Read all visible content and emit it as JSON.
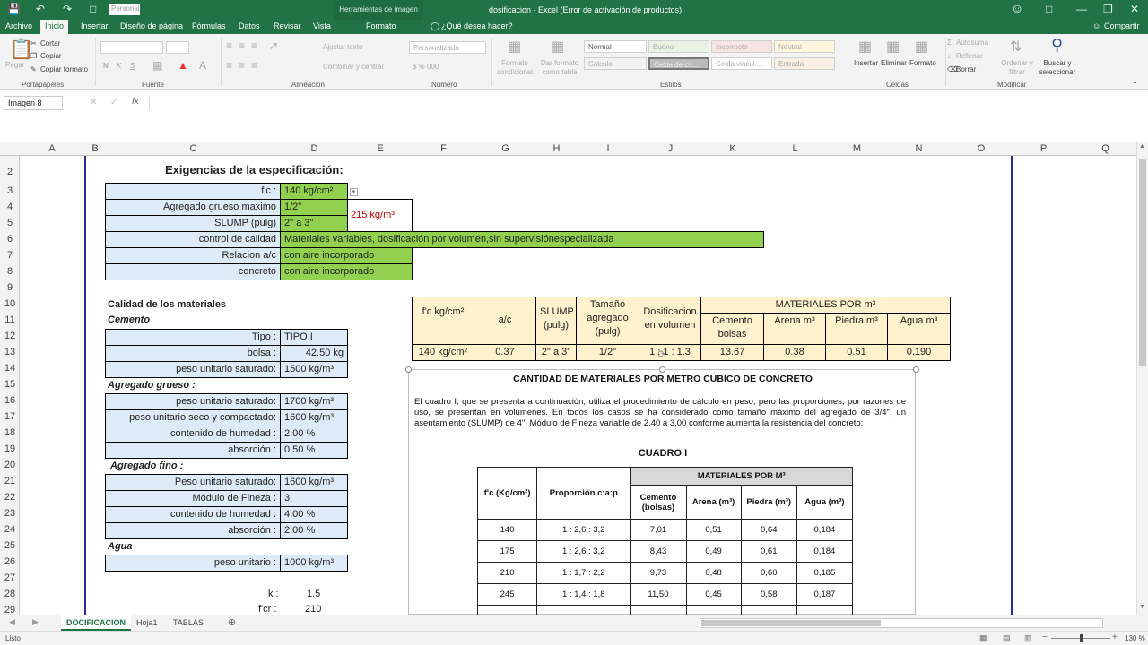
{
  "titlebar": {
    "doc_title": "dosificacion - Excel (Error de activación de productos)",
    "context_tab": "Herramientas de imagen",
    "font_box": "Personal"
  },
  "tabs": [
    "Archivo",
    "Inicio",
    "Insertar",
    "Diseño de página",
    "Fórmulas",
    "Datos",
    "Revisar",
    "Vista",
    "Formato"
  ],
  "tell_me": "¿Qué desea hacer?",
  "share": "Compartir",
  "ribbon": {
    "clipboard": {
      "paste": "Pegar",
      "cut": "Cortar",
      "copy": "Copiar",
      "format_painter": "Copiar formato",
      "label": "Portapapeles"
    },
    "font": {
      "label": "Fuente",
      "bold": "N",
      "italic": "K",
      "underline": "S"
    },
    "alignment": {
      "wrap": "Ajustar texto",
      "merge": "Combinar y centrar",
      "label": "Alineación"
    },
    "number": {
      "format": "Personalizada",
      "label": "Número"
    },
    "styles": {
      "conditional": "Formato condicional",
      "as_table": "Dar formato como tabla",
      "normal": "Normal",
      "bueno": "Bueno",
      "incorrecto": "Incorrecto",
      "neutral": "Neutral",
      "calculo": "Cálculo",
      "celda_co": "Celda de co...",
      "celda_vinc": "Celda vincul...",
      "entrada": "Entrada",
      "label": "Estilos"
    },
    "cells": {
      "insert": "Insertar",
      "delete": "Eliminar",
      "format": "Formato",
      "label": "Celdas"
    },
    "editing": {
      "autosum": "Autosuma",
      "fill": "Rellenar",
      "clear": "Borrar",
      "sort": "Ordenar y filtrar",
      "find": "Buscar y seleccionar",
      "label": "Modificar"
    }
  },
  "namebox": "Imagen 8",
  "fx": "fx",
  "columns": [
    "A",
    "B",
    "C",
    "D",
    "E",
    "F",
    "G",
    "H",
    "I",
    "J",
    "K",
    "L",
    "M",
    "N",
    "O",
    "P",
    "Q"
  ],
  "rows": [
    "2",
    "3",
    "4",
    "5",
    "6",
    "7",
    "8",
    "9",
    "10",
    "11",
    "12",
    "13",
    "14",
    "15",
    "16",
    "17",
    "18",
    "19",
    "20",
    "21",
    "22",
    "23",
    "24",
    "25",
    "26",
    "27",
    "28",
    "29"
  ],
  "sheet": {
    "heading": "Exigencias de la especificación:",
    "spec": [
      [
        "f'c :",
        "140 kg/cm²"
      ],
      [
        "Agregado grueso maximo",
        "1/2\""
      ],
      [
        "SLUMP (pulg)",
        "2\" a 3\""
      ],
      [
        "control de calidad",
        "Materiales variables, dosificación por volumen,sin supervisiónespecializada"
      ],
      [
        "Relacion a/c",
        "con aire incorporado"
      ],
      [
        "concreto",
        "con aire incorporado"
      ]
    ],
    "water_note": "215 kg/m³",
    "quality_title": "Calidad de los materiales",
    "cement_title": "Cemento",
    "cement": [
      [
        "Tipo :",
        "TIPO I"
      ],
      [
        "bolsa :",
        "42.50 kg"
      ],
      [
        "peso unitario saturado:",
        "1500 kg/m³"
      ]
    ],
    "coarse_title": "Agregado grueso :",
    "coarse": [
      [
        "peso unitario saturado:",
        "1700 kg/m³"
      ],
      [
        "peso unitario seco y compactado:",
        "1600 kg/m³"
      ],
      [
        "contenido de humedad :",
        "2.00 %"
      ],
      [
        "absorción :",
        "0.50 %"
      ]
    ],
    "fine_title": "Agregado fino :",
    "fine": [
      [
        "Peso unitario saturado:",
        "1600 kg/m³"
      ],
      [
        "Módulo de Fineza :",
        "3"
      ],
      [
        "contenido de humedad :",
        "4.00 %"
      ],
      [
        "absorción :",
        "2.00 %"
      ]
    ],
    "water_title": "Agua",
    "water": [
      [
        "peso unitario :",
        "1000 kg/m³"
      ]
    ],
    "k_label": "k :",
    "k_val": "1.5",
    "fcr_label": "f'cr :",
    "fcr_val": "210",
    "mix": {
      "h_fc": "f'c kg/cm²",
      "h_ac": "a/c",
      "h_slump": "SLUMP (pulg)",
      "h_tam": "Tamaño agregado (pulg)",
      "h_dos": "Dosificacion en volumen",
      "h_mat": "MATERIALES POR m³",
      "h_cem": "Cemento bolsas",
      "h_are": "Arena m³",
      "h_pie": "Piedra m³",
      "h_agu": "Agua m³",
      "v": [
        "140 kg/cm²",
        "0.37",
        "2\" a 3\"",
        "1/2\"",
        "1 : 1 : 1.3",
        "13.67",
        "0.38",
        "0.51",
        "0.190"
      ]
    },
    "image": {
      "title": "CANTIDAD DE MATERIALES POR METRO CUBICO DE CONCRETO",
      "para": "El cuadro I, que se presenta a continuación, utiliza el procedimiento de cálculo en peso, pero las proporciones, por razones de uso, se presentan en volúmenes. En todos los casos se ha considerado como tamaño máximo del agregado de 3/4\", un asentamiento (SLUMP) de 4\", Módulo de Fineza variable de 2.40 a 3,00 conforme aumenta la resistencia del concreto:",
      "cuadro": "CUADRO I",
      "t_mat": "MATERIALES POR M³",
      "t_fc": "f'c (Kg/cm²)",
      "t_prop": "Proporción c:a:p",
      "t_cem": "Cemento (bolsas)",
      "t_are": "Arena (m³)",
      "t_pie": "Piedra (m³)",
      "t_agu": "Agua (m³)",
      "rows": [
        [
          "140",
          "1 : 2,6 : 3,2",
          "7,01",
          "0,51",
          "0,64",
          "0,184"
        ],
        [
          "175",
          "1 : 2,6 : 3,2",
          "8,43",
          "0,49",
          "0,61",
          "0,184"
        ],
        [
          "210",
          "1 : 1,7 : 2,2",
          "9,73",
          "0,48",
          "0,60",
          "0,185"
        ],
        [
          "245",
          "1 : 1,4 : 1,8",
          "11,50",
          "0,45",
          "0,58",
          "0,187"
        ]
      ]
    }
  },
  "sheet_tabs": [
    "DOCIFICACION",
    "Hoja1",
    "TABLAS"
  ],
  "status": {
    "ready": "Listo",
    "zoom": "130 %"
  }
}
